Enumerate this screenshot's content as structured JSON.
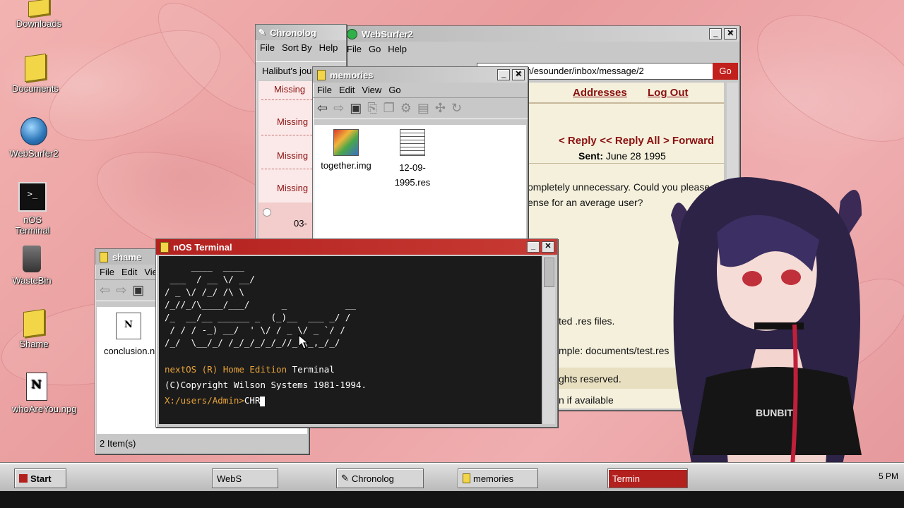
{
  "desktop_icons": [
    {
      "label": "Downloads",
      "icon": "folder-icon"
    },
    {
      "label": "Documents",
      "icon": "folder-icon"
    },
    {
      "label": "WebSurfer2",
      "icon": "globe-icon"
    },
    {
      "label": "nOS Terminal",
      "icon": "terminal-icon"
    },
    {
      "label": "WasteBin",
      "icon": "trash-icon"
    },
    {
      "label": "Shame",
      "icon": "folder-icon"
    },
    {
      "label": "whoAreYou.npg",
      "icon": "document-icon"
    }
  ],
  "chronolog": {
    "title": "Chronolog",
    "menu": [
      "File",
      "Sort By",
      "Help"
    ],
    "header": "Halibut's jou",
    "rows": [
      "Missing",
      "Missing",
      "Missing",
      "Missing"
    ],
    "date_fragment": "03-"
  },
  "websurfer": {
    "title": "WebSurfer2",
    "menu": [
      "File",
      "Go",
      "Help"
    ],
    "address": "nmailer.com/esounder/inbox/message/2",
    "go_label": "Go",
    "nav_links": [
      "Addresses",
      "Log Out"
    ],
    "actions": [
      "< Reply",
      "<< Reply All",
      "> Forward"
    ],
    "sent_label": "Sent:",
    "sent_date": "June 28 1995",
    "body_line1": "ompletely unnecessary. Could you please",
    "body_line2": "ense for an average user?",
    "body_line3": "ted .res files.",
    "body_line4": "mple: documents/test.res",
    "footer_line1": "ghts reserved.",
    "footer_line2": "n if available"
  },
  "memories": {
    "title": "memories",
    "menu": [
      "File",
      "Edit",
      "View",
      "Go"
    ],
    "files": [
      {
        "name": "together.img",
        "icon": "image-file-icon"
      },
      {
        "name": "12-09-1995.res",
        "icon": "res-file-icon"
      }
    ]
  },
  "shame": {
    "title": "shame",
    "menu": [
      "File",
      "Edit",
      "View"
    ],
    "files": [
      {
        "name": "conclusion.npg",
        "icon": "document-icon"
      }
    ],
    "status": "2 Item(s)"
  },
  "terminal": {
    "title": "nOS Terminal",
    "ascii_art": "     ____  ____\n ___  / __ \\/ __/\n/ _ \\/ /_/ /\\ \\\n/_//_/\\____/___/      _           __\n/_  __/__ ______ _  (_)__  ___ _/ /\n / / / -_) __/  ' \\/ / _ \\/ _ `/ /\n/_/  \\__/_/ /_/_/_/_/_//_/\\_,_/_/",
    "line1_brand": "nextOS (R) Home Edition",
    "line1_rest": " Terminal",
    "line2": "(C)Copyright Wilson Systems 1981-1994.",
    "prompt": "X:/users/Admin>",
    "input": "CHR"
  },
  "taskbar": {
    "start_label": "Start",
    "items": [
      "WebS",
      "Chronolog",
      "memories",
      "Termin"
    ],
    "clock": "5 PM"
  },
  "colors": {
    "active_title": "#b3211f",
    "desktop_pink": "#eea6a6",
    "link_red": "#8b1010",
    "terminal_bg": "#1b1b1b",
    "terminal_orange": "#e9a43a"
  }
}
